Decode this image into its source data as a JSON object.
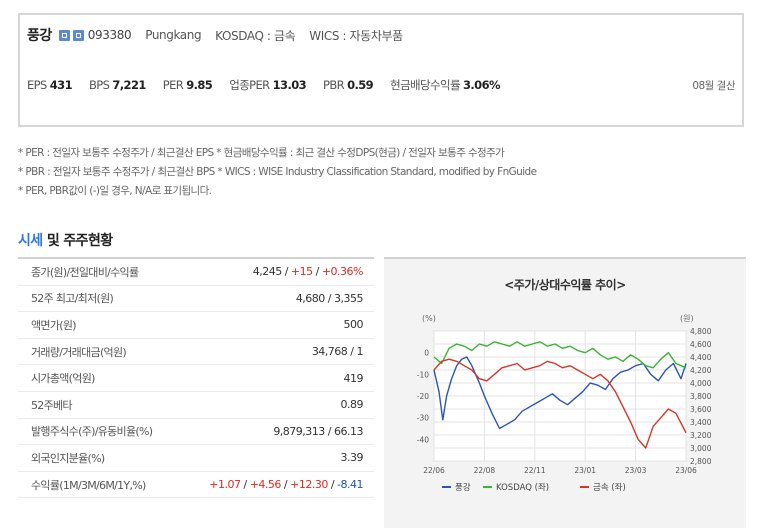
{
  "header": {
    "company_name": "풍강",
    "code": "093380",
    "english_name": "Pungkang",
    "market": "KOSDAQ : 금속",
    "wics": "WICS : 자동차부품",
    "settlement": "08월 결산",
    "metrics": [
      {
        "label": "EPS",
        "value": "431"
      },
      {
        "label": "BPS",
        "value": "7,221"
      },
      {
        "label": "PER",
        "value": "9.85"
      },
      {
        "label": "업종PER",
        "value": "13.03"
      },
      {
        "label": "PBR",
        "value": "0.59"
      },
      {
        "label": "현금배당수익률",
        "value": "3.06%"
      }
    ]
  },
  "notes": [
    "* PER : 전일자 보통주 수정주가 / 최근결산 EPS * 현금배당수익률 : 최근 결산 수정DPS(현금) / 전일자 보통주 수정주가",
    "* PBR : 전일자 보통주 수정주가 / 최근결산 BPS * WICS : WISE Industry Classification Standard, modified by FnGuide",
    "* PER, PBR값이 (-)일 경우, N/A로 표기됩니다."
  ],
  "section": {
    "title_accent": "시세",
    "title_rest": " 및 주주현황"
  },
  "table": {
    "price_label": "종가(원)/전일대비/수익률",
    "price_value": "4,245",
    "price_sep": " / ",
    "price_change": "+15",
    "price_change_pct": "+0.36%",
    "rows": [
      {
        "label": "52주 최고/최저(원)",
        "value": "4,680 / 3,355"
      },
      {
        "label": "액면가(원)",
        "value": "500"
      },
      {
        "label": "거래량/거래대금(억원)",
        "value": "34,768 / 1"
      },
      {
        "label": "시가총액(억원)",
        "value": "419"
      },
      {
        "label": "52주베타",
        "value": "0.89"
      },
      {
        "label": "발행주식수(주)/유동비율(%)",
        "value": "9,879,313 / 66.13"
      },
      {
        "label": "외국인지분율(%)",
        "value": "3.39"
      }
    ],
    "returns_label": "수익률(1M/3M/6M/1Y,%)",
    "returns": [
      "+1.07",
      "+4.56",
      "+12.30",
      "-8.41"
    ]
  },
  "chart_data": {
    "type": "line",
    "title": "<주가/상대수익률 추이>",
    "left_unit": "(%)",
    "right_unit": "(원)",
    "ylim_left": [
      -50,
      10
    ],
    "ylim_right": [
      2800,
      4800
    ],
    "left_ticks": [
      "0",
      "-10",
      "-20",
      "-30",
      "-40"
    ],
    "left_tick_values": [
      0,
      -10,
      -20,
      -30,
      -40
    ],
    "right_ticks": [
      "4,800",
      "4,600",
      "4,400",
      "4,200",
      "4,000",
      "3,800",
      "3,600",
      "3,400",
      "3,200",
      "3,000",
      "2,800"
    ],
    "right_tick_values": [
      4800,
      4600,
      4400,
      4200,
      4000,
      3800,
      3600,
      3400,
      3200,
      3000,
      2800
    ],
    "x_ticks": [
      "22/06",
      "22/08",
      "22/11",
      "23/01",
      "23/03",
      "23/06"
    ],
    "x_tick_positions": [
      0,
      0.2,
      0.4,
      0.6,
      0.8,
      1.0
    ],
    "grid": true,
    "legend_position": "bottom",
    "series": [
      {
        "name": "풍강",
        "color": "#2a56b8",
        "axis": "left",
        "x": [
          0,
          0.02,
          0.035,
          0.05,
          0.07,
          0.09,
          0.11,
          0.13,
          0.15,
          0.18,
          0.2,
          0.23,
          0.26,
          0.29,
          0.32,
          0.35,
          0.38,
          0.41,
          0.44,
          0.47,
          0.5,
          0.53,
          0.56,
          0.59,
          0.62,
          0.65,
          0.68,
          0.71,
          0.74,
          0.77,
          0.8,
          0.83,
          0.86,
          0.89,
          0.92,
          0.95,
          0.98,
          1.0
        ],
        "values": [
          -8,
          -18,
          -31,
          -20,
          -12,
          -6,
          -3,
          -2,
          -6,
          -14,
          -20,
          -28,
          -35,
          -33,
          -31,
          -27,
          -25,
          -23,
          -21,
          -19,
          -22,
          -24,
          -21,
          -18,
          -14,
          -15,
          -17,
          -12,
          -9,
          -8,
          -6,
          -5,
          -10,
          -13,
          -8,
          -5,
          -12,
          -5
        ]
      },
      {
        "name": "KOSDAQ (좌)",
        "color": "#3ab234",
        "axis": "left",
        "x": [
          0,
          0.03,
          0.06,
          0.09,
          0.12,
          0.15,
          0.18,
          0.21,
          0.24,
          0.27,
          0.3,
          0.33,
          0.36,
          0.39,
          0.42,
          0.45,
          0.48,
          0.51,
          0.54,
          0.57,
          0.6,
          0.63,
          0.66,
          0.69,
          0.72,
          0.75,
          0.78,
          0.81,
          0.84,
          0.87,
          0.9,
          0.93,
          0.96,
          1.0
        ],
        "values": [
          -2,
          -5,
          2,
          4,
          3,
          1,
          4,
          3,
          5,
          4,
          3,
          5,
          3,
          4,
          5,
          3,
          4,
          2,
          3,
          1,
          0,
          2,
          -1,
          -3,
          -2,
          -4,
          -1,
          -3,
          -6,
          -7,
          -3,
          0,
          -5,
          -7
        ]
      },
      {
        "name": "금속 (좌)",
        "color": "#d6362a",
        "axis": "left",
        "x": [
          0,
          0.03,
          0.06,
          0.09,
          0.12,
          0.15,
          0.18,
          0.21,
          0.24,
          0.27,
          0.3,
          0.33,
          0.36,
          0.39,
          0.42,
          0.45,
          0.48,
          0.51,
          0.54,
          0.57,
          0.6,
          0.63,
          0.66,
          0.69,
          0.72,
          0.75,
          0.78,
          0.81,
          0.84,
          0.87,
          0.9,
          0.93,
          0.96,
          1.0
        ],
        "values": [
          -8,
          -4,
          -3,
          -4,
          -6,
          -8,
          -12,
          -13,
          -10,
          -7,
          -6,
          -5,
          -8,
          -7,
          -6,
          -4,
          -5,
          -7,
          -6,
          -8,
          -10,
          -12,
          -10,
          -13,
          -18,
          -25,
          -32,
          -40,
          -44,
          -34,
          -30,
          -26,
          -28,
          -37
        ]
      }
    ]
  }
}
